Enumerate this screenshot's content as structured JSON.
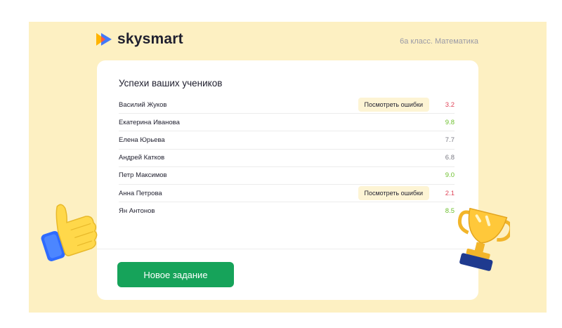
{
  "brand": {
    "name": "skysmart",
    "colors": {
      "accent": "#16a35a",
      "background": "#fdf0c2"
    }
  },
  "header": {
    "class_label": "6а класс. Математика"
  },
  "results": {
    "title": "Успехи ваших учеников",
    "error_button_label": "Посмотреть ошибки",
    "students": [
      {
        "name": "Василий Жуков",
        "score": "3.2",
        "status": "red",
        "has_errors": true
      },
      {
        "name": "Екатерина Иванова",
        "score": "9.8",
        "status": "green",
        "has_errors": false
      },
      {
        "name": "Елена Юрьева",
        "score": "7.7",
        "status": "gray",
        "has_errors": false
      },
      {
        "name": "Андрей Катков",
        "score": "6.8",
        "status": "gray",
        "has_errors": false
      },
      {
        "name": "Петр Максимов",
        "score": "9.0",
        "status": "green",
        "has_errors": false
      },
      {
        "name": "Анна Петрова",
        "score": "2.1",
        "status": "red",
        "has_errors": true
      },
      {
        "name": "Ян Антонов",
        "score": "8.5",
        "status": "green",
        "has_errors": false
      }
    ]
  },
  "actions": {
    "new_task_label": "Новое задание"
  },
  "decor": {
    "left": "thumbs-up-icon",
    "right": "trophy-icon"
  }
}
